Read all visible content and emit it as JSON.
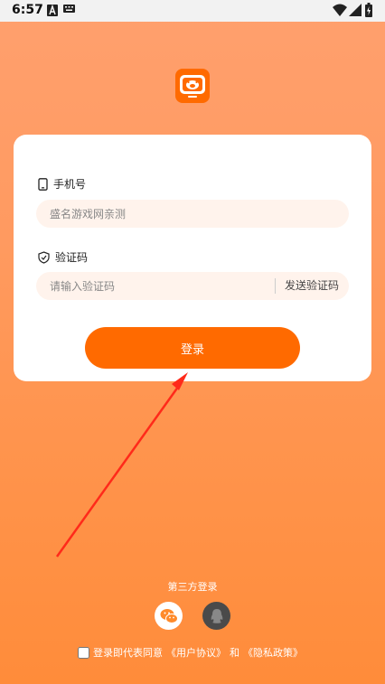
{
  "status_bar": {
    "time": "6:57"
  },
  "colors": {
    "accent": "#FF6A00",
    "input_bg": "#FFF3EC",
    "arrow": "#FF2A1A"
  },
  "form": {
    "phone_label": "手机号",
    "phone_placeholder": "盛名游戏网亲测",
    "code_label": "验证码",
    "code_placeholder": "请输入验证码",
    "send_code": "发送验证码",
    "login": "登录"
  },
  "third_party": {
    "title": "第三方登录",
    "icons": [
      "wechat-icon",
      "qq-icon"
    ]
  },
  "agreement": {
    "prefix": "登录即代表同意",
    "user_agreement": "《用户协议》",
    "and": "和",
    "privacy_policy": "《隐私政策》",
    "checked": false
  }
}
